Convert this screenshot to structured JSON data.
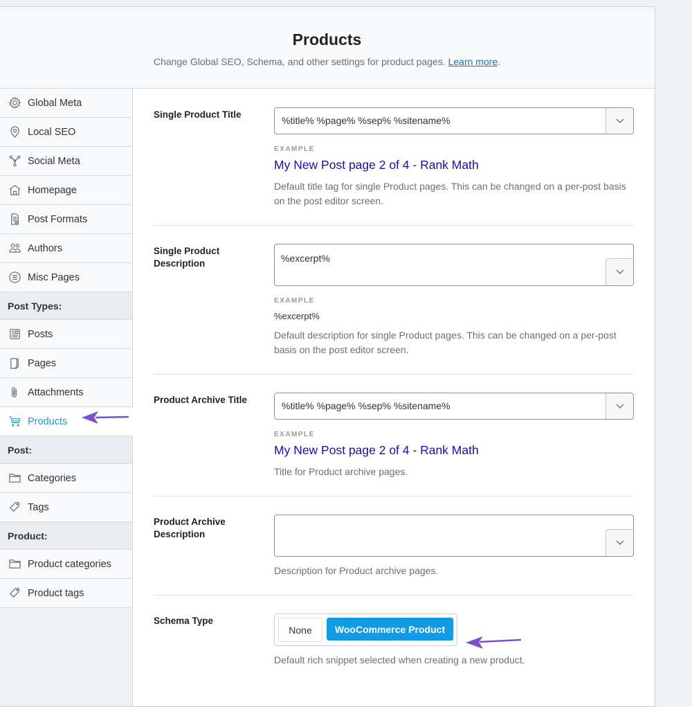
{
  "header": {
    "title": "Products",
    "subtitle": "Change Global SEO, Schema, and other settings for product pages.",
    "learn_more": "Learn more",
    "trailing": "."
  },
  "sidebar": {
    "items": [
      {
        "label": "Global Meta",
        "icon": "gear-icon"
      },
      {
        "label": "Local SEO",
        "icon": "location-pin-icon"
      },
      {
        "label": "Social Meta",
        "icon": "share-nodes-icon"
      },
      {
        "label": "Homepage",
        "icon": "home-icon"
      },
      {
        "label": "Post Formats",
        "icon": "document-icon"
      },
      {
        "label": "Authors",
        "icon": "users-icon"
      },
      {
        "label": "Misc Pages",
        "icon": "list-circle-icon"
      }
    ],
    "post_types_heading": "Post Types:",
    "post_types": [
      {
        "label": "Posts",
        "icon": "post-icon"
      },
      {
        "label": "Pages",
        "icon": "page-icon"
      },
      {
        "label": "Attachments",
        "icon": "paperclip-icon"
      },
      {
        "label": "Products",
        "icon": "cart-icon",
        "active": true
      }
    ],
    "post_heading": "Post:",
    "post": [
      {
        "label": "Categories",
        "icon": "folder-icon"
      },
      {
        "label": "Tags",
        "icon": "tag-icon"
      }
    ],
    "product_heading": "Product:",
    "product": [
      {
        "label": "Product categories",
        "icon": "folder-icon"
      },
      {
        "label": "Product tags",
        "icon": "tag-icon"
      }
    ]
  },
  "fields": {
    "single_title": {
      "label": "Single Product Title",
      "value": "%title% %page% %sep% %sitename%",
      "example_label": "EXAMPLE",
      "example": "My New Post page 2 of 4 - Rank Math",
      "desc": "Default title tag for single Product pages. This can be changed on a per-post basis on the post editor screen."
    },
    "single_desc": {
      "label": "Single Product Description",
      "value": "%excerpt%",
      "example_label": "EXAMPLE",
      "example": "%excerpt%",
      "desc": "Default description for single Product pages. This can be changed on a per-post basis on the post editor screen."
    },
    "archive_title": {
      "label": "Product Archive Title",
      "value": "%title% %page% %sep% %sitename%",
      "example_label": "EXAMPLE",
      "example": "My New Post page 2 of 4 - Rank Math",
      "desc": "Title for Product archive pages."
    },
    "archive_desc": {
      "label": "Product Archive Description",
      "value": "",
      "desc": "Description for Product archive pages."
    },
    "schema": {
      "label": "Schema Type",
      "options": [
        "None",
        "WooCommerce Product"
      ],
      "selected": "WooCommerce Product",
      "desc": "Default rich snippet selected when creating a new product."
    }
  },
  "colors": {
    "accent": "#129ae2",
    "active_nav": "#1a9bd3",
    "example_title": "#1a0dab",
    "annotation_arrow": "#7b4fc9"
  }
}
